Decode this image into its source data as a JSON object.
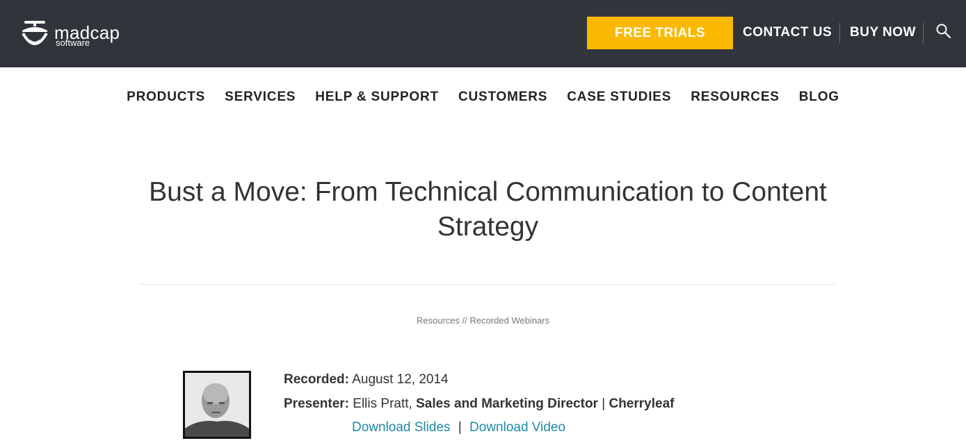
{
  "header": {
    "logo": {
      "word": "madcap",
      "sub": "software"
    },
    "free_trials": "FREE TRIALS",
    "contact_us": "CONTACT US",
    "buy_now": "BUY NOW",
    "search_icon": "search-icon"
  },
  "nav": {
    "items": [
      "PRODUCTS",
      "SERVICES",
      "HELP & SUPPORT",
      "CUSTOMERS",
      "CASE STUDIES",
      "RESOURCES",
      "BLOG"
    ]
  },
  "page": {
    "title": "Bust a Move: From Technical Communication to Content Strategy",
    "breadcrumb": {
      "resources": "Resources",
      "separator": " // ",
      "current": "Recorded Webinars"
    }
  },
  "webinar": {
    "recorded_label": "Recorded:",
    "recorded_value": "August 12, 2014",
    "presenter_label": "Presenter:",
    "presenter_name": "Ellis Pratt,",
    "presenter_role": "Sales and Marketing Director",
    "sep": "|",
    "presenter_company": "Cherryleaf",
    "download_slides": "Download Slides",
    "download_sep": "|",
    "download_video": "Download Video"
  },
  "colors": {
    "header_bg": "#31343a",
    "accent": "#fab900",
    "link": "#1b8ba4"
  }
}
